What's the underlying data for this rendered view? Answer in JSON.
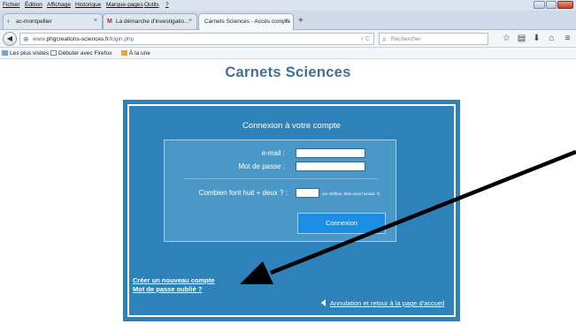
{
  "menu": {
    "items": [
      "Fichier",
      "Édition",
      "Affichage",
      "Historique",
      "Marque-pages",
      "Outils",
      "?"
    ]
  },
  "tabs": [
    {
      "label": "ac-montpellier",
      "close": "×"
    },
    {
      "label": "La démarche d'investigatio...",
      "close": "×"
    },
    {
      "label": "Carnets Sciences - Accès compte",
      "close": "×"
    }
  ],
  "new_tab": "+",
  "address": {
    "prefix": "www.",
    "domain": "phgcreations-sciences.fr",
    "path": "/login.php"
  },
  "search": {
    "placeholder": "Rechercher"
  },
  "bookmarks": {
    "items": [
      "Les plus visités",
      "Débuter avec Firefox",
      "À la une"
    ]
  },
  "page": {
    "site_title": "Carnets Sciences",
    "panel_title": "Connexion à votre compte",
    "email_label": "e-mail :",
    "password_label": "Mot de passe :",
    "captcha_label": "Combien font huit + deux ? :",
    "captcha_hint": "(en chiffres, êtes vous humain ?)",
    "connect_button": "Connexion",
    "create_account_link": "Créer un nouveau compte",
    "forgot_password_link": "Mot de passe oublié ?",
    "cancel_link": "Annulation et retour à la page d'accueil",
    "email_value": "",
    "password_value": "",
    "captcha_value": ""
  },
  "colors": {
    "panel_bg": "#2d82b9",
    "form_bg": "#4a98c8",
    "button_bg": "#1c8ee4",
    "title_color": "#3f6f9a",
    "annotation_arrow": "#000000"
  }
}
